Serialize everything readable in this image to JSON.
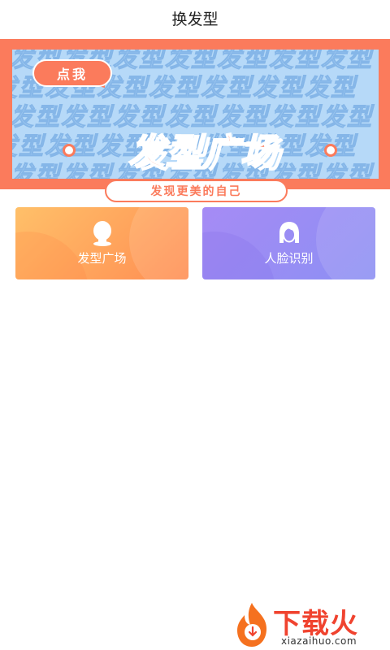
{
  "header": {
    "title": "换发型"
  },
  "banner": {
    "tag_label": "点我",
    "title": "发型广场",
    "subtitle": "发现更美的自己",
    "pattern_text": "发型",
    "colors": {
      "frame": "#fb7b5c",
      "background": "#b6d9f8",
      "pattern": "#85b6e8"
    }
  },
  "cards": [
    {
      "label": "发型广场",
      "icon": "hair-head-icon",
      "color": "#ff9a57"
    },
    {
      "label": "人脸识别",
      "icon": "face-outline-icon",
      "color": "#9a8cf4"
    }
  ],
  "watermark": {
    "brand": "下载火",
    "url": "xiazaihuo.com",
    "icon": "flame-logo-icon"
  }
}
